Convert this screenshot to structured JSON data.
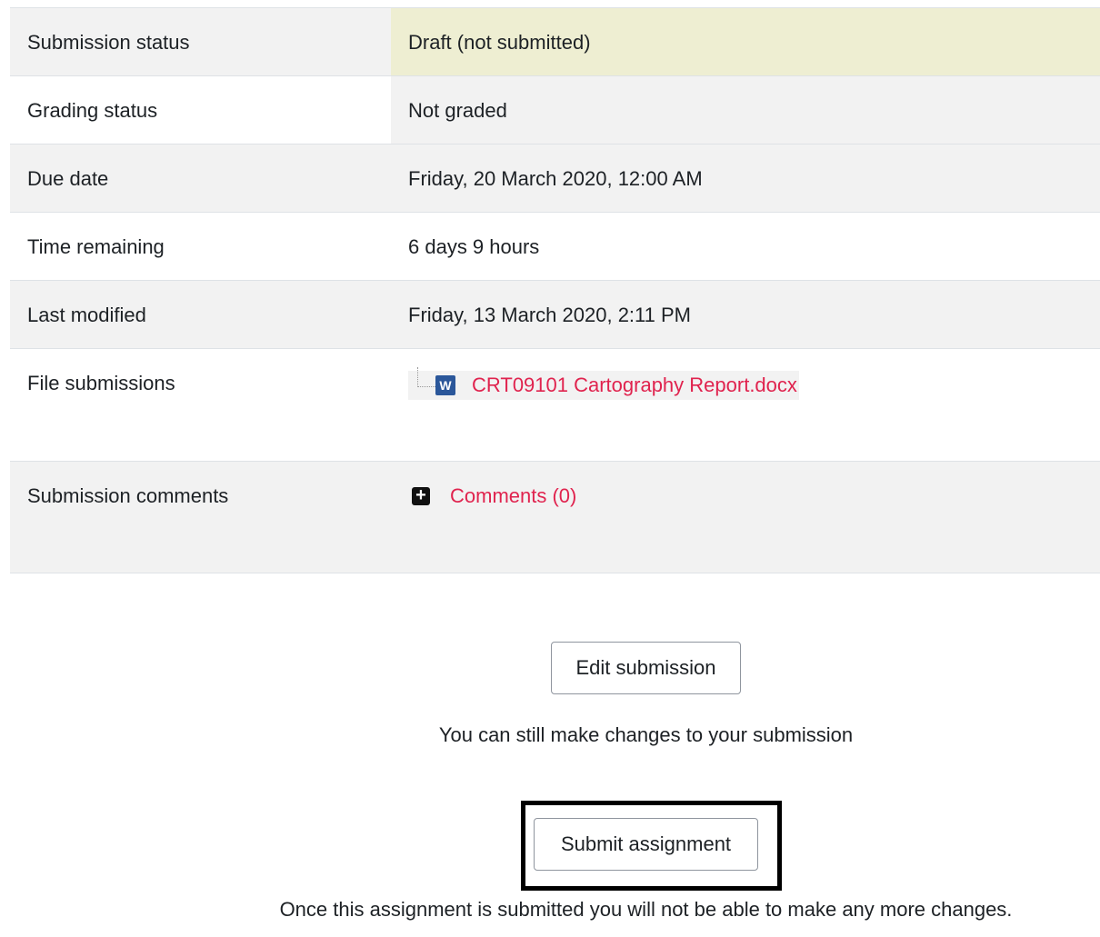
{
  "status_table": [
    {
      "label": "Submission status",
      "value": "Draft (not submitted)"
    },
    {
      "label": "Grading status",
      "value": "Not graded"
    },
    {
      "label": "Due date",
      "value": "Friday, 20 March 2020, 12:00 AM"
    },
    {
      "label": "Time remaining",
      "value": "6 days 9 hours"
    },
    {
      "label": "Last modified",
      "value": "Friday, 13 March 2020, 2:11 PM"
    }
  ],
  "file_submissions": {
    "label": "File submissions",
    "file_icon": "word-icon",
    "file_name": "CRT09101 Cartography Report.docx"
  },
  "submission_comments": {
    "label": "Submission comments",
    "toggle_icon": "plus-icon",
    "link": "Comments (0)"
  },
  "actions": {
    "edit_label": "Edit submission",
    "edit_note": "You can still make changes to your submission",
    "submit_label": "Submit assignment",
    "submit_note": "Once this assignment is submitted you will not be able to make any more changes."
  },
  "colors": {
    "status_highlight": "#eeeed2",
    "link": "#e0234e",
    "row_shade": "#f2f2f2"
  }
}
